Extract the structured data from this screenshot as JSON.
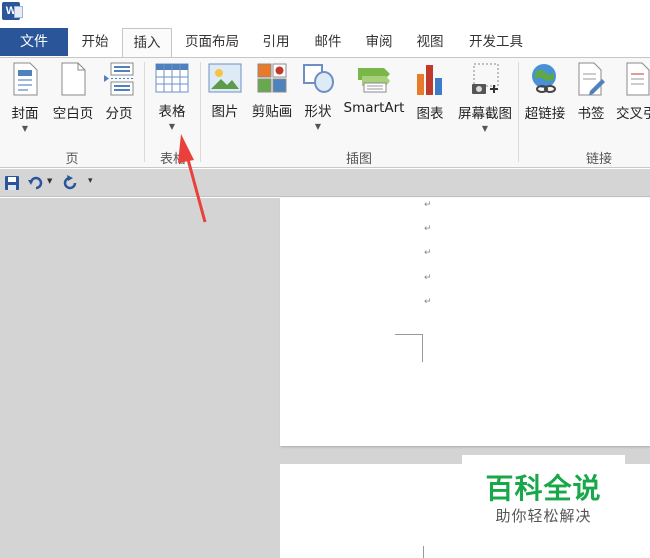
{
  "app": {
    "icon_letter": "W"
  },
  "tabs": [
    {
      "label": "文件"
    },
    {
      "label": "开始"
    },
    {
      "label": "插入"
    },
    {
      "label": "页面布局"
    },
    {
      "label": "引用"
    },
    {
      "label": "邮件"
    },
    {
      "label": "审阅"
    },
    {
      "label": "视图"
    },
    {
      "label": "开发工具"
    }
  ],
  "ribbon": {
    "buttons": {
      "cover": "封面",
      "blank_page": "空白页",
      "page_break": "分页",
      "table": "表格",
      "picture": "图片",
      "clipart": "剪贴画",
      "shapes": "形状",
      "smartart": "SmartArt",
      "chart": "图表",
      "screenshot": "屏幕截图",
      "hyperlink": "超链接",
      "bookmark": "书签",
      "cross_ref": "交叉引"
    },
    "groups": {
      "pages": "页",
      "tables": "表格",
      "illustrations": "插图",
      "links": "链接"
    }
  },
  "document": {
    "paragraph_mark": "↵"
  },
  "watermark": {
    "title": "百科全说",
    "subtitle": "助你轻松解决"
  },
  "colors": {
    "file_tab": "#2a5699",
    "annotation_arrow": "#e8413c",
    "watermark": "#18a84a"
  }
}
